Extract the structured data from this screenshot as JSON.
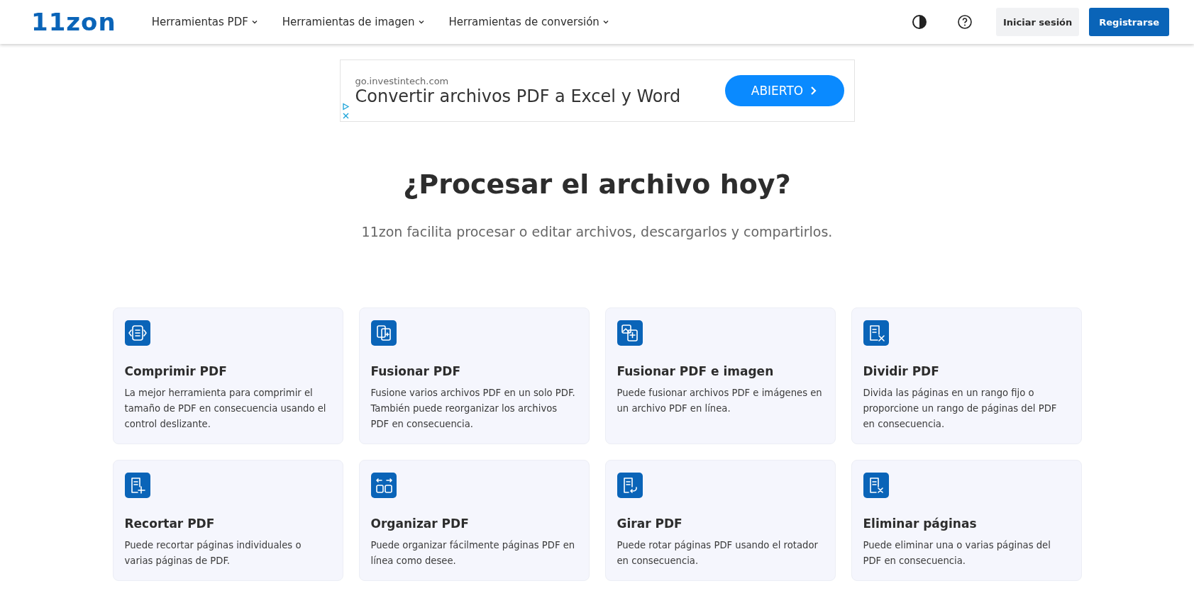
{
  "header": {
    "logo": "11zon",
    "nav": [
      {
        "label": "Herramientas PDF"
      },
      {
        "label": "Herramientas de imagen"
      },
      {
        "label": "Herramientas de conversión"
      }
    ],
    "login": "Iniciar sesión",
    "register": "Registrarse"
  },
  "ad": {
    "domain": "go.investintech.com",
    "headline": "Convertir archivos PDF a Excel y Word",
    "button": "ABIERTO"
  },
  "hero": {
    "title": "¿Procesar el archivo hoy?",
    "subtitle": "11zon facilita procesar o editar archivos, descargarlos y compartirlos."
  },
  "tools": [
    {
      "kind": "compress",
      "title": "Comprimir PDF",
      "description": "La mejor herramienta para comprimir el tamaño de PDF en consecuencia usando el control deslizante."
    },
    {
      "kind": "merge",
      "title": "Fusionar PDF",
      "description": "Fusione varios archivos PDF en un solo PDF. También puede reorganizar los archivos PDF en consecuencia."
    },
    {
      "kind": "merge-image",
      "title": "Fusionar PDF e imagen",
      "description": "Puede fusionar archivos PDF e imágenes en un archivo PDF en línea."
    },
    {
      "kind": "split",
      "title": "Dividir PDF",
      "description": "Divida las páginas en un rango fijo o proporcione un rango de páginas del PDF en consecuencia."
    },
    {
      "kind": "crop",
      "title": "Recortar PDF",
      "description": "Puede recortar páginas individuales o varias páginas de PDF."
    },
    {
      "kind": "organize",
      "title": "Organizar PDF",
      "description": "Puede organizar fácilmente páginas PDF en línea como desee."
    },
    {
      "kind": "rotate",
      "title": "Girar PDF",
      "description": "Puede rotar páginas PDF usando el rotador en consecuencia."
    },
    {
      "kind": "delete",
      "title": "Eliminar páginas",
      "description": "Puede eliminar una o varias páginas del PDF en consecuencia."
    }
  ]
}
